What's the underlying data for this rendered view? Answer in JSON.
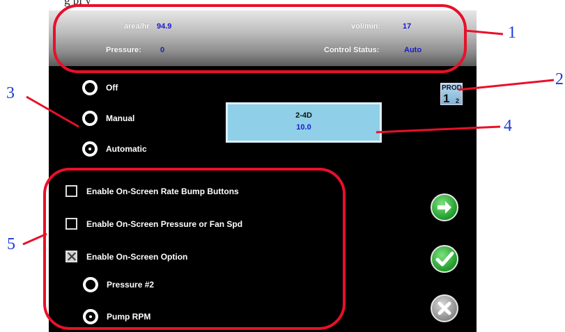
{
  "caption": "g                    pl y",
  "status": {
    "area_label": "area/hr",
    "area_value": "94.9",
    "vol_label": "vol/min:",
    "vol_value": "17",
    "pressure_label": "Pressure:",
    "pressure_value": "0",
    "control_label": "Control Status:",
    "control_value": "Auto"
  },
  "control_mode": {
    "options": [
      "Off",
      "Manual",
      "Automatic"
    ],
    "selected": "Automatic"
  },
  "product": {
    "name": "2-4D",
    "rate": "10.0"
  },
  "prod_icon": {
    "text": "PROD",
    "one": "1",
    "two": "2",
    "icon": "product-select-icon"
  },
  "options": {
    "rate_bump": {
      "label": "Enable On-Screen Rate Bump Buttons",
      "checked": false
    },
    "pressure_fan": {
      "label": "Enable On-Screen Pressure or Fan Spd",
      "checked": false
    },
    "onscreen_option": {
      "label": "Enable On-Screen Option",
      "checked": true
    },
    "sub_options": [
      "Pressure #2",
      "Pump RPM"
    ],
    "sub_selected": "Pump RPM"
  },
  "buttons": {
    "next": "arrow-right-icon",
    "accept": "checkmark-icon",
    "cancel": "close-icon"
  },
  "callouts": [
    "1",
    "2",
    "3",
    "4",
    "5"
  ],
  "colors": {
    "callout_red": "#e8102a",
    "callout_blue": "#1a3ad8",
    "value_blue": "#1a1acc",
    "product_box": "#8fd0e8",
    "button_green": "#1f9a2a"
  }
}
